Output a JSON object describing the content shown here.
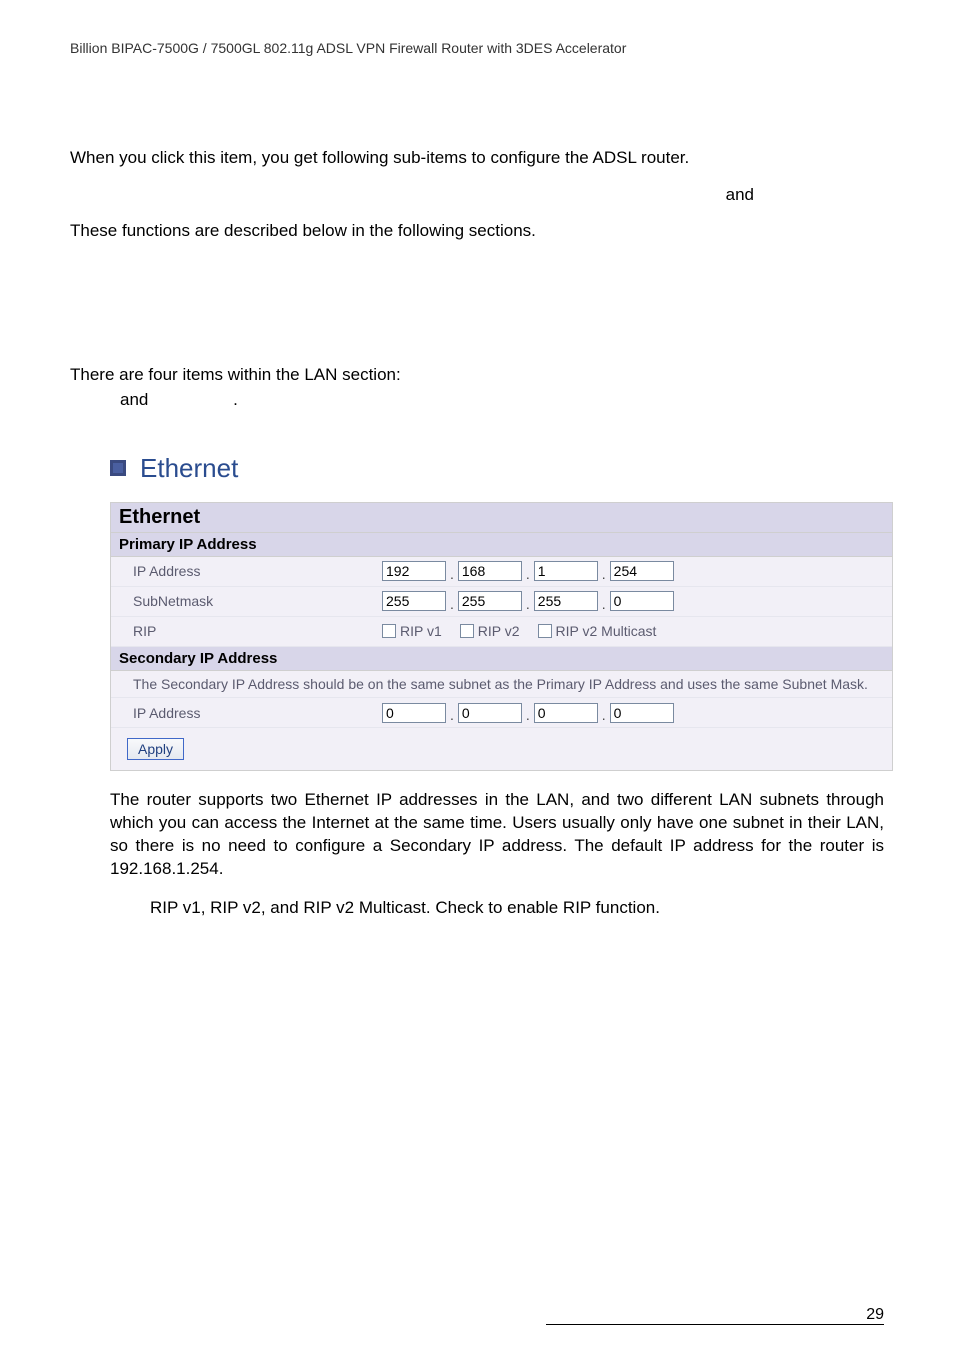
{
  "header": {
    "text": "Billion BIPAC-7500G / 7500GL 802.11g ADSL VPN Firewall Router with 3DES Accelerator"
  },
  "intro": {
    "line1": "When you click this item, you get following sub-items to configure the ADSL router.",
    "and1": "and",
    "line2": "These functions are described below in the following sections."
  },
  "lan_section": {
    "line1": "There are four items within the LAN section:",
    "and": "and",
    "dot": "."
  },
  "section": {
    "title": "Ethernet"
  },
  "table": {
    "title": "Ethernet",
    "primary_title": "Primary IP Address",
    "labels": {
      "ipaddress": "IP Address",
      "subnetmask": "SubNetmask",
      "rip": "RIP"
    },
    "ip": {
      "a": "192",
      "b": "168",
      "c": "1",
      "d": "254"
    },
    "mask": {
      "a": "255",
      "b": "255",
      "c": "255",
      "d": "0"
    },
    "rip": {
      "v1": "RIP v1",
      "v2": "RIP v2",
      "mc": "RIP v2 Multicast"
    },
    "secondary_title": "Secondary IP Address",
    "secondary_note": "The Secondary IP Address should be on the same subnet as the Primary IP Address and uses the same Subnet Mask.",
    "sip": {
      "a": "0",
      "b": "0",
      "c": "0",
      "d": "0"
    },
    "apply": "Apply"
  },
  "desc": {
    "para1": "The router supports two Ethernet IP addresses in the LAN, and two different LAN subnets through which you can access the Internet at the same time. Users usually only have one subnet in their LAN, so there is no need to configure a Secondary IP address. The default IP address for the router is 192.168.1.254.",
    "para2": "RIP v1, RIP v2, and RIP v2 Multicast. Check to enable RIP function."
  },
  "footer": {
    "page": "29"
  }
}
